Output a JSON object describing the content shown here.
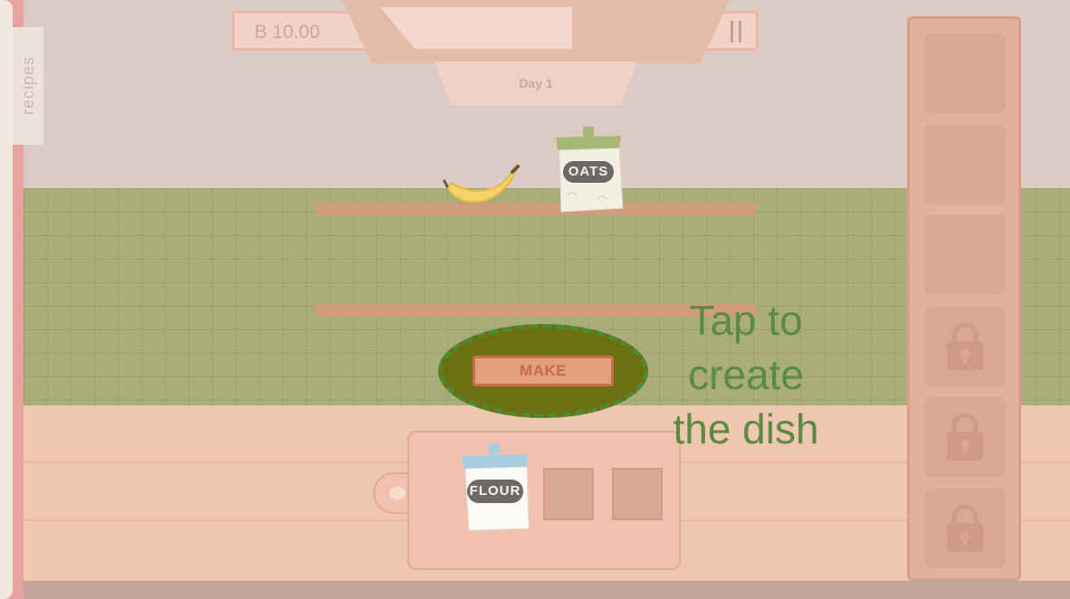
{
  "hud": {
    "money": "B 10.00",
    "day_label": "Day 1"
  },
  "recipes_tab": {
    "label": "recipes"
  },
  "shelf_items": [
    {
      "name": "banana",
      "icon": "banana-icon"
    },
    {
      "name": "oats",
      "label": "OATS",
      "icon": "oats-jar-icon"
    }
  ],
  "board": {
    "ingredient": {
      "label": "FLOUR",
      "icon": "flour-jar-icon"
    },
    "empty_slots": 2
  },
  "make_button": {
    "label": "MAKE"
  },
  "tutorial": {
    "line1": "Tap to",
    "line2": "create",
    "line3": "the dish"
  },
  "inventory": {
    "slots": [
      {
        "locked": false
      },
      {
        "locked": false
      },
      {
        "locked": false
      },
      {
        "locked": true
      },
      {
        "locked": true
      },
      {
        "locked": true
      }
    ]
  },
  "colors": {
    "wall": "#dccbc4",
    "tiles": "#a9ae79",
    "counter": "#efc6ae",
    "hint_text": "#5b8a44",
    "highlight_border": "#4f8a33",
    "make_button": "#e3a07e"
  }
}
